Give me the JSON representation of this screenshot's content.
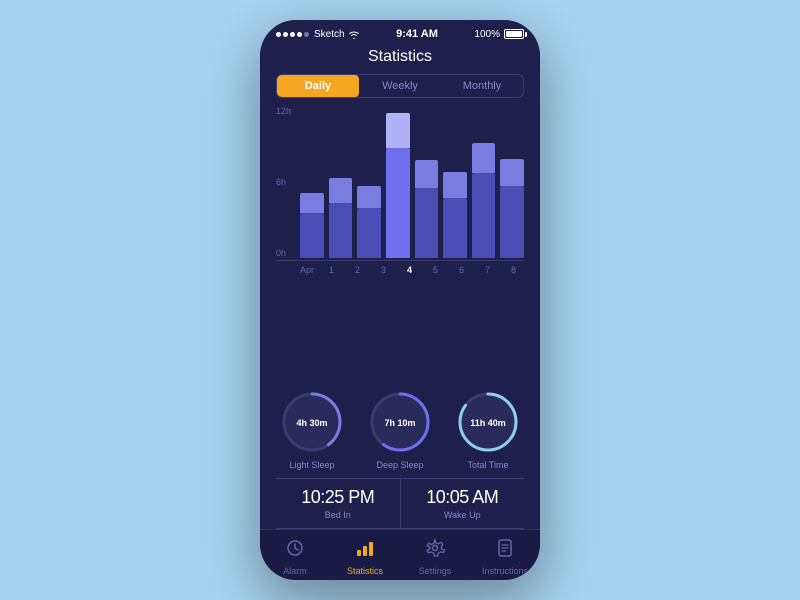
{
  "statusBar": {
    "carrier": "Sketch",
    "time": "9:41 AM",
    "battery": "100%"
  },
  "header": {
    "title": "Statistics"
  },
  "tabs": [
    {
      "label": "Daily",
      "active": true
    },
    {
      "label": "Weekly",
      "active": false
    },
    {
      "label": "Monthly",
      "active": false
    }
  ],
  "chart": {
    "yLabels": [
      "12h",
      "6h",
      "0h"
    ],
    "xLabels": [
      "Apr",
      "1",
      "2",
      "3",
      "4",
      "5",
      "6",
      "7",
      "8"
    ],
    "bars": [
      {
        "day": "1",
        "deep": 45,
        "light": 20,
        "selected": false
      },
      {
        "day": "2",
        "deep": 55,
        "light": 25,
        "selected": false
      },
      {
        "day": "3",
        "deep": 50,
        "light": 22,
        "selected": false
      },
      {
        "day": "4",
        "deep": 110,
        "light": 35,
        "selected": true
      },
      {
        "day": "5",
        "deep": 70,
        "light": 28,
        "selected": false
      },
      {
        "day": "6",
        "deep": 60,
        "light": 26,
        "selected": false
      },
      {
        "day": "7",
        "deep": 85,
        "light": 30,
        "selected": false
      },
      {
        "day": "8",
        "deep": 72,
        "light": 27,
        "selected": false
      }
    ]
  },
  "stats": [
    {
      "value": "4h 30m",
      "label": "Light Sleep",
      "percent": 40,
      "color": "#7a7de0",
      "bg": "#2e2f60"
    },
    {
      "value": "7h 10m",
      "label": "Deep Sleep",
      "percent": 60,
      "color": "#6e70ee",
      "bg": "#2e2f60"
    },
    {
      "value": "11h 40m",
      "label": "Total Time",
      "percent": 85,
      "color": "#8ecfee",
      "bg": "#2e2f60"
    }
  ],
  "times": [
    {
      "main": "10:25 PM",
      "sub": "Bed In"
    },
    {
      "main": "10:05 AM",
      "sub": "Wake Up"
    }
  ],
  "nav": [
    {
      "icon": "⏰",
      "label": "Alarm",
      "active": false
    },
    {
      "icon": "📊",
      "label": "Statistics",
      "active": true
    },
    {
      "icon": "⚙️",
      "label": "Settings",
      "active": false
    },
    {
      "icon": "📋",
      "label": "Instructions",
      "active": false
    }
  ]
}
